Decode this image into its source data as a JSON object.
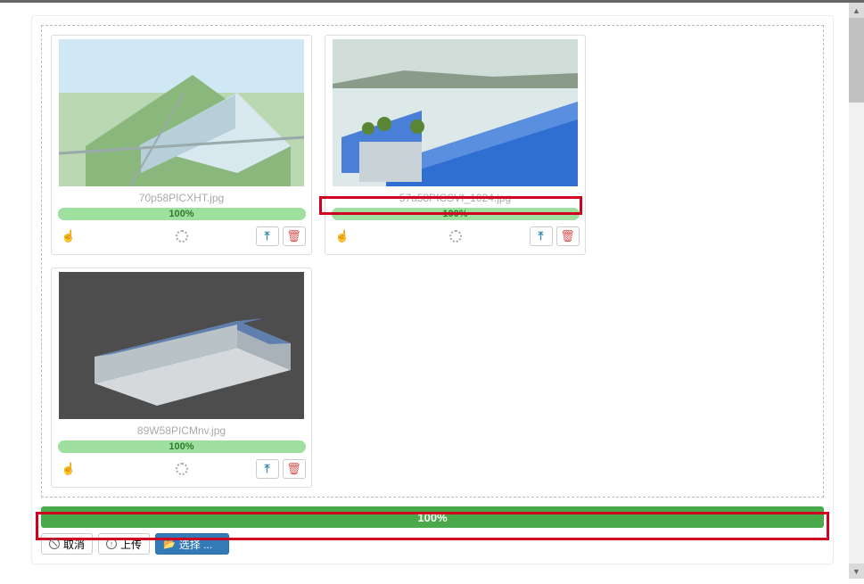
{
  "files": [
    {
      "name": "70p58PICXHT.jpg",
      "progress_label": "100%"
    },
    {
      "name": "57a58PICSVf_1024.jpg",
      "progress_label": "100%"
    },
    {
      "name": "89W58PICMnv.jpg",
      "progress_label": "100%"
    }
  ],
  "overall_progress_label": "100%",
  "buttons": {
    "cancel": "取消",
    "upload": "上传",
    "select": "选择 ..."
  },
  "colors": {
    "highlight": "#d00020",
    "progress_card": "#9fdf9f",
    "progress_overall": "#4aa94a",
    "select_button": "#337ab7"
  }
}
